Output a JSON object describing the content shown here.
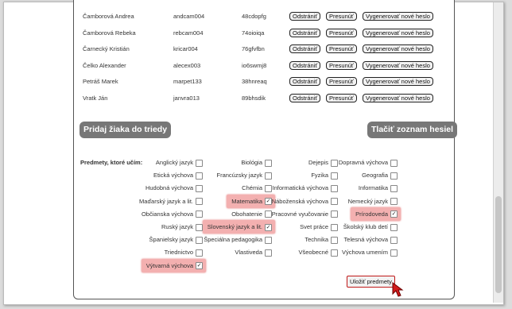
{
  "students": [
    {
      "name": "Čamborová Andrea",
      "login": "andcam004",
      "password": "48cdopfg"
    },
    {
      "name": "Čamborová Rebeka",
      "login": "rebcam004",
      "password": "74oioiqa"
    },
    {
      "name": "Čarnecký Kristián",
      "login": "kricar004",
      "password": "76gfvfbn"
    },
    {
      "name": "Čelko Alexander",
      "login": "alecex003",
      "password": "io6swmj8"
    },
    {
      "name": "Petráš Marek",
      "login": "marpet133",
      "password": "38hnreaq"
    },
    {
      "name": "Vratk Ján",
      "login": "janvra013",
      "password": "89bhsdik"
    }
  ],
  "row_actions": {
    "remove": "Odstrániť",
    "move": "Presunúť",
    "regenerate": "Vygenerovať nové heslo"
  },
  "buttons": {
    "add_student": "Pridaj žiaka do triedy",
    "print_passwords": "Tlačiť zoznam hesiel",
    "save_subjects": "Uložiť predmety"
  },
  "subjects_label": "Predmety, ktoré učím:",
  "subjects": [
    [
      "Anglický jazyk",
      "Biológia",
      "Dejepis",
      "Dopravná výchova"
    ],
    [
      "Etická výchova",
      "Francúzsky jazyk",
      "Fyzika",
      "Geografia"
    ],
    [
      "Hudobná výchova",
      "Chémia",
      "Informatická výchova",
      "Informatika"
    ],
    [
      "Maďarský jazyk a lit.",
      "Matematika",
      "Náboženská výchova",
      "Nemecký jazyk"
    ],
    [
      "Občianska výchova",
      "Obohatenie",
      "Pracovné vyučovanie",
      "Prírodoveda"
    ],
    [
      "Ruský jazyk",
      "Slovenský jazyk a lit.",
      "Svet práce",
      "Školský klub detí"
    ],
    [
      "Španielsky jazyk",
      "Špeciálna pedagogika",
      "Technika",
      "Telesná výchova"
    ],
    [
      "Triednictvo",
      "Vlastiveda",
      "Všeobecné",
      "Výchova umením"
    ],
    [
      "Výtvarná výchova"
    ]
  ],
  "checked": [
    "Matematika",
    "Prírodoveda",
    "Slovenský jazyk a lit.",
    "Výtvarná výchova"
  ],
  "colors": {
    "highlight": "#f3b0b0",
    "accent_red": "#c01818",
    "button_gray": "#777777"
  }
}
